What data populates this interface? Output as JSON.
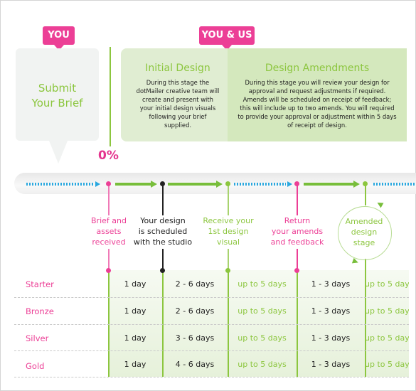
{
  "tags": {
    "you": "YOU",
    "you_and_us": "YOU & US"
  },
  "brief": {
    "title_line1": "Submit",
    "title_line2": "Your Brief"
  },
  "progress": {
    "percent_label": "0%"
  },
  "initial_design": {
    "title": "Initial Design",
    "body": [
      "During this stage the",
      "dotMailer creative team will",
      "create and present with",
      "your initial design visuals",
      "following your brief",
      "supplied."
    ]
  },
  "design_amendments": {
    "title": "Design Amendments",
    "body": [
      "During this stage you will review your design for",
      "approval and request adjustments if required.",
      "Amends will be scheduled on receipt of feedback;",
      "this will include up to two amends. You will required",
      "to provide your approval or adjustment within 5 days",
      "of receipt of design."
    ]
  },
  "milestones": [
    {
      "lines": [
        "Brief and",
        "assets",
        "received"
      ],
      "color": "#ec3f96"
    },
    {
      "lines": [
        "Your design",
        "is scheduled",
        "with the studio"
      ],
      "color": "#222222"
    },
    {
      "lines": [
        "Receive your",
        "1st design",
        "visual"
      ],
      "color": "#8cc63f"
    },
    {
      "lines": [
        "Return",
        "your amends",
        "and feedback"
      ],
      "color": "#ec3f96"
    },
    {
      "lines": [
        "Amended",
        "design",
        "stage"
      ],
      "color": "#8cc63f"
    }
  ],
  "table": {
    "rows": [
      {
        "tier": "Starter",
        "cells": [
          "1 day",
          "2 - 6 days",
          "up to 5 days",
          "1 - 3 days",
          "up to 5 days"
        ]
      },
      {
        "tier": "Bronze",
        "cells": [
          "1 day",
          "2 - 6 days",
          "up to 5 days",
          "1 - 3 days",
          "up to 5 days"
        ]
      },
      {
        "tier": "Silver",
        "cells": [
          "1 day",
          "3 - 6 days",
          "up to 5 days",
          "1 - 3 days",
          "up to 5 days"
        ]
      },
      {
        "tier": "Gold",
        "cells": [
          "1 day",
          "4 - 6 days",
          "up to 5 days",
          "1 - 3 days",
          "up to 5 days"
        ]
      }
    ]
  },
  "colors": {
    "pink": "#ec3f96",
    "green": "#8cc63f",
    "blue": "#2aa8df",
    "dark": "#222222"
  }
}
